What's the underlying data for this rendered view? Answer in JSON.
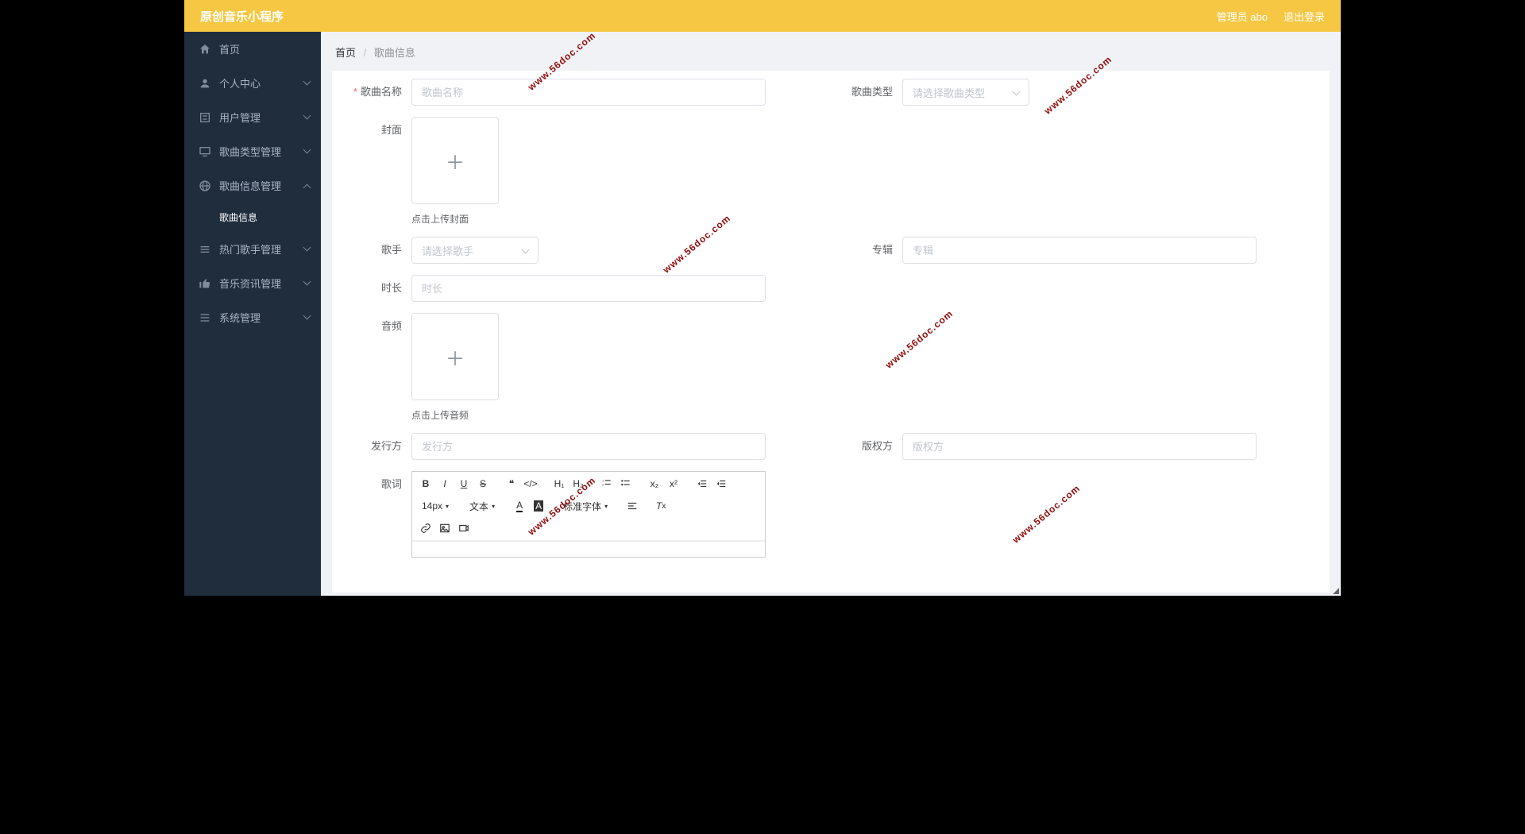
{
  "header": {
    "title": "原创音乐小程序",
    "admin": "管理员 abo",
    "logout": "退出登录"
  },
  "sidebar": {
    "items": [
      {
        "label": "首页",
        "icon": "home",
        "expand": ""
      },
      {
        "label": "个人中心",
        "icon": "person",
        "expand": "down"
      },
      {
        "label": "用户管理",
        "icon": "list",
        "expand": "down"
      },
      {
        "label": "歌曲类型管理",
        "icon": "monitor",
        "expand": "down"
      },
      {
        "label": "歌曲信息管理",
        "icon": "globe",
        "expand": "up",
        "sub": [
          {
            "label": "歌曲信息"
          }
        ]
      },
      {
        "label": "热门歌手管理",
        "icon": "bars",
        "expand": "down"
      },
      {
        "label": "音乐资讯管理",
        "icon": "thumb",
        "expand": "down"
      },
      {
        "label": "系统管理",
        "icon": "menu",
        "expand": "down"
      }
    ]
  },
  "crumbs": {
    "home": "首页",
    "current": "歌曲信息"
  },
  "form": {
    "song_name": {
      "label": "歌曲名称",
      "placeholder": "歌曲名称"
    },
    "song_type": {
      "label": "歌曲类型",
      "placeholder": "请选择歌曲类型"
    },
    "cover": {
      "label": "封面",
      "hint": "点击上传封面"
    },
    "singer": {
      "label": "歌手",
      "placeholder": "请选择歌手"
    },
    "album": {
      "label": "专辑",
      "placeholder": "专辑"
    },
    "duration": {
      "label": "时长",
      "placeholder": "时长"
    },
    "audio": {
      "label": "音频",
      "hint": "点击上传音频"
    },
    "publisher": {
      "label": "发行方",
      "placeholder": "发行方"
    },
    "copyright": {
      "label": "版权方",
      "placeholder": "版权方"
    },
    "lyrics": {
      "label": "歌词"
    }
  },
  "editor": {
    "font_size": "14px",
    "font_family": "文本",
    "font_spec": "标准字体"
  },
  "watermark": "www.56doc.com"
}
